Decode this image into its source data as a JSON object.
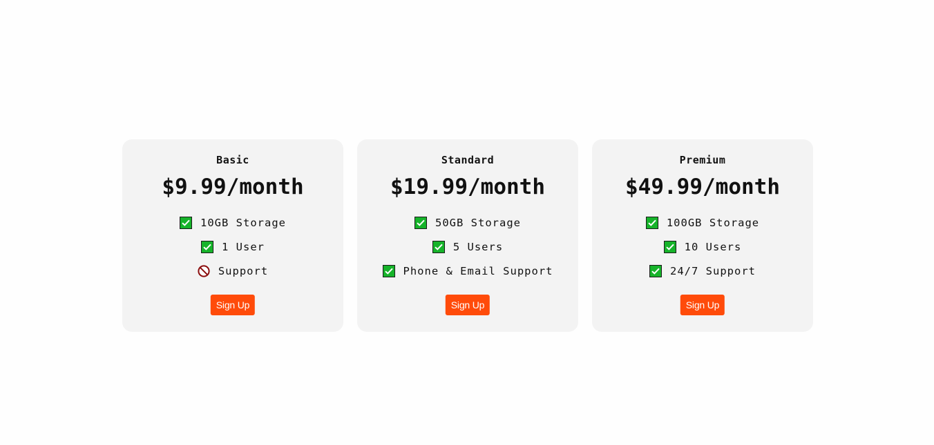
{
  "colors": {
    "page_background": "#fefefe",
    "card_background": "#f3f3f3",
    "button_background": "#ff4b0a",
    "button_text": "#ffffff",
    "check_green": "#16b32a",
    "prohibited_red": "#8b0d0d"
  },
  "plans": [
    {
      "name": "Basic",
      "price": "$9.99/month",
      "features": [
        {
          "icon": "check-icon",
          "text": "10GB Storage"
        },
        {
          "icon": "check-icon",
          "text": "1 User"
        },
        {
          "icon": "prohibited-icon",
          "text": "Support"
        }
      ],
      "button_label": "Sign Up"
    },
    {
      "name": "Standard",
      "price": "$19.99/month",
      "features": [
        {
          "icon": "check-icon",
          "text": "50GB Storage"
        },
        {
          "icon": "check-icon",
          "text": "5 Users"
        },
        {
          "icon": "check-icon",
          "text": "Phone & Email Support"
        }
      ],
      "button_label": "Sign Up"
    },
    {
      "name": "Premium",
      "price": "$49.99/month",
      "features": [
        {
          "icon": "check-icon",
          "text": "100GB Storage"
        },
        {
          "icon": "check-icon",
          "text": "10 Users"
        },
        {
          "icon": "check-icon",
          "text": "24/7 Support"
        }
      ],
      "button_label": "Sign Up"
    }
  ]
}
